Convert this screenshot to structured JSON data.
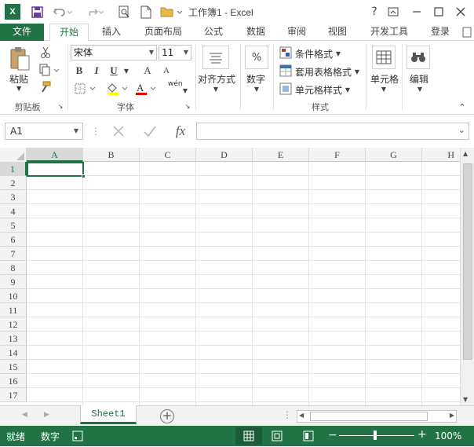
{
  "title": "工作簿1 - Excel",
  "tabs": {
    "file": "文件",
    "home": "开始",
    "insert": "插入",
    "layout": "页面布局",
    "formulas": "公式",
    "data": "数据",
    "review": "审阅",
    "view": "视图",
    "developer": "开发工具",
    "login": "登录"
  },
  "ribbon": {
    "paste": "粘贴",
    "clipboard": "剪贴板",
    "font_name": "宋体",
    "font_size": "11",
    "font_group": "字体",
    "wen": "wén",
    "align": "对齐方式",
    "number": "数字",
    "percent": "%",
    "cond_format": "条件格式",
    "table_format": "套用表格格式",
    "cell_style": "单元格样式",
    "styles_group": "样式",
    "cells": "单元格",
    "edit": "编辑",
    "bold": "B",
    "italic": "I",
    "underline": "U",
    "grow": "A",
    "shrink": "A"
  },
  "namebox": "A1",
  "fx": "fx",
  "columns": [
    "A",
    "B",
    "C",
    "D",
    "E",
    "F",
    "G",
    "H"
  ],
  "rows": [
    "1",
    "2",
    "3",
    "4",
    "5",
    "6",
    "7",
    "8",
    "9",
    "10",
    "11",
    "12",
    "13",
    "14",
    "15",
    "16",
    "17"
  ],
  "sheet_tab": "Sheet1",
  "status": {
    "ready": "就绪",
    "numlock": "数字",
    "zoom": "100%"
  },
  "colors": {
    "accent": "#217346"
  }
}
